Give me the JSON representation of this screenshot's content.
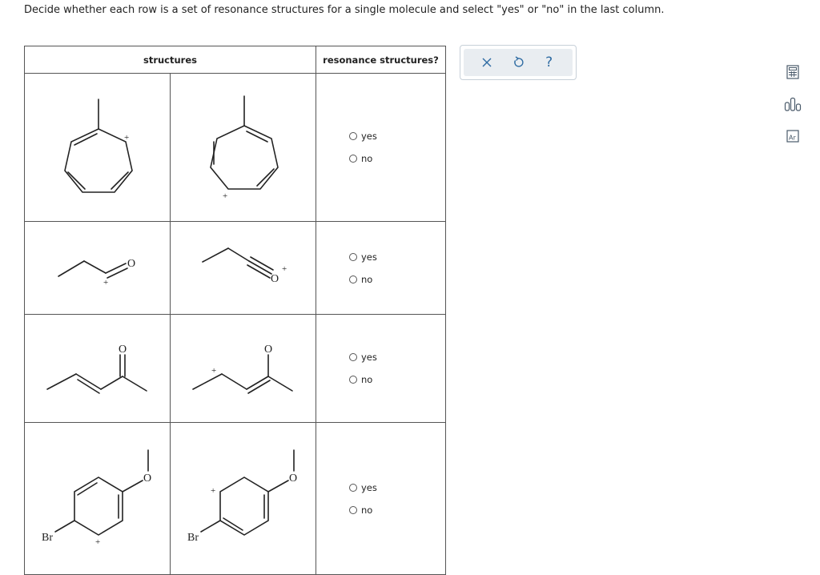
{
  "instructions": "Decide whether each row is a set of resonance structures for a single molecule and select \"yes\" or \"no\" in the last column.",
  "table": {
    "header_structures": "structures",
    "header_resonance": "resonance structures?",
    "rows": [
      {
        "yes": "yes",
        "no": "no"
      },
      {
        "yes": "yes",
        "no": "no"
      },
      {
        "yes": "yes",
        "no": "no"
      },
      {
        "yes": "yes",
        "no": "no"
      }
    ]
  },
  "atoms": {
    "oxygen": "O",
    "bromine": "Br",
    "plus": "+"
  },
  "toolbar": {
    "icons": [
      "close-icon",
      "undo-icon",
      "help-icon"
    ],
    "help_glyph": "?",
    "accent": "#2f6ca3"
  },
  "side_tools": {
    "icons": [
      "calculator-icon",
      "bar-chart-icon",
      "periodic-table-icon"
    ],
    "periodic_label": "Ar"
  }
}
